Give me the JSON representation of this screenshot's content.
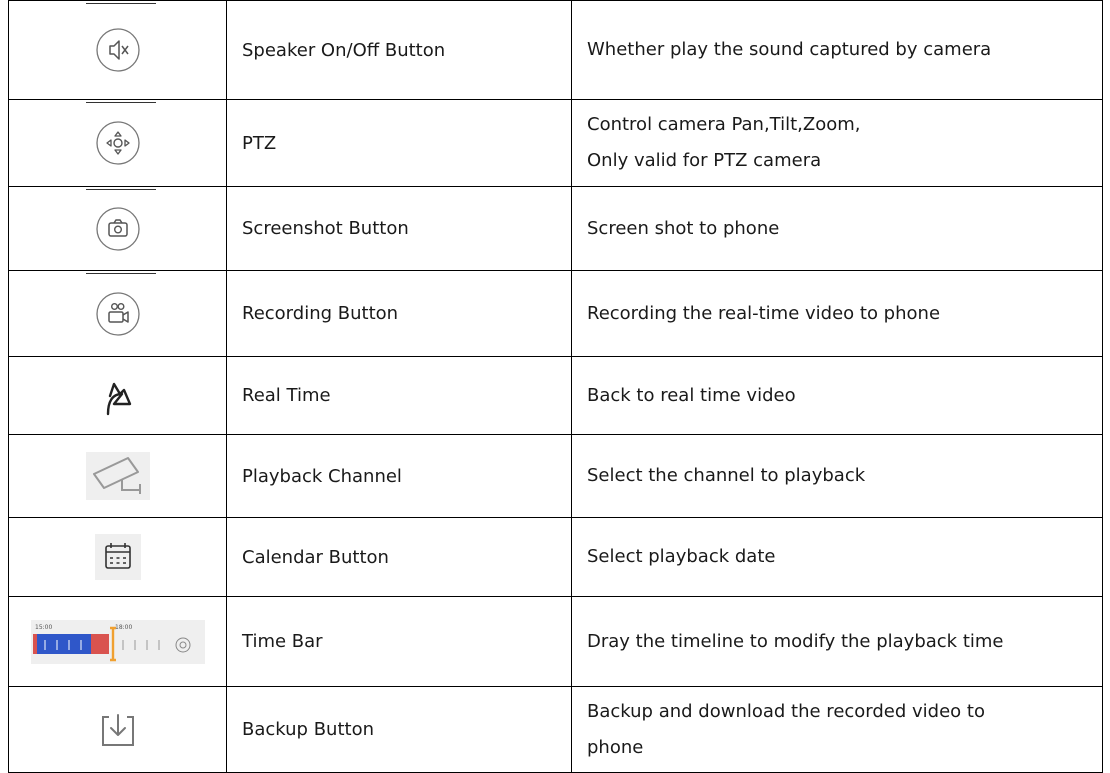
{
  "rows": [
    {
      "icon": "speaker-mute-icon",
      "name": "Speaker On/Off Button",
      "desc": [
        "Whether play the sound captured by camera"
      ]
    },
    {
      "icon": "ptz-icon",
      "name": "PTZ",
      "desc": [
        "Control camera Pan,Tilt,Zoom,",
        "Only valid for PTZ camera"
      ]
    },
    {
      "icon": "camera-icon",
      "name": "Screenshot Button",
      "desc": [
        "Screen shot to phone"
      ]
    },
    {
      "icon": "video-record-icon",
      "name": "Recording Button",
      "desc": [
        "Recording the real-time video to phone"
      ]
    },
    {
      "icon": "return-arrow-icon",
      "name": "Real Time",
      "desc": [
        "Back to real time video"
      ]
    },
    {
      "icon": "cctv-camera-icon",
      "name": "Playback Channel",
      "desc": [
        "Select the channel to playback"
      ]
    },
    {
      "icon": "calendar-icon",
      "name": "Calendar Button",
      "desc": [
        "Select playback date"
      ]
    },
    {
      "icon": "time-bar-icon",
      "name": "Time Bar",
      "desc": [
        "Dray the timeline to modify the playback time"
      ]
    },
    {
      "icon": "download-tray-icon",
      "name": "Backup Button",
      "desc": [
        "Backup and download the recorded video to",
        "phone"
      ]
    }
  ],
  "timebar": {
    "label_left": "15:00",
    "label_right": "18:00"
  },
  "colors": {
    "border": "#000000",
    "icon_stroke": "#555555",
    "timebar_blue": "#2f57c9",
    "timebar_red": "#d9534f",
    "timebar_cursor": "#f0a030"
  }
}
